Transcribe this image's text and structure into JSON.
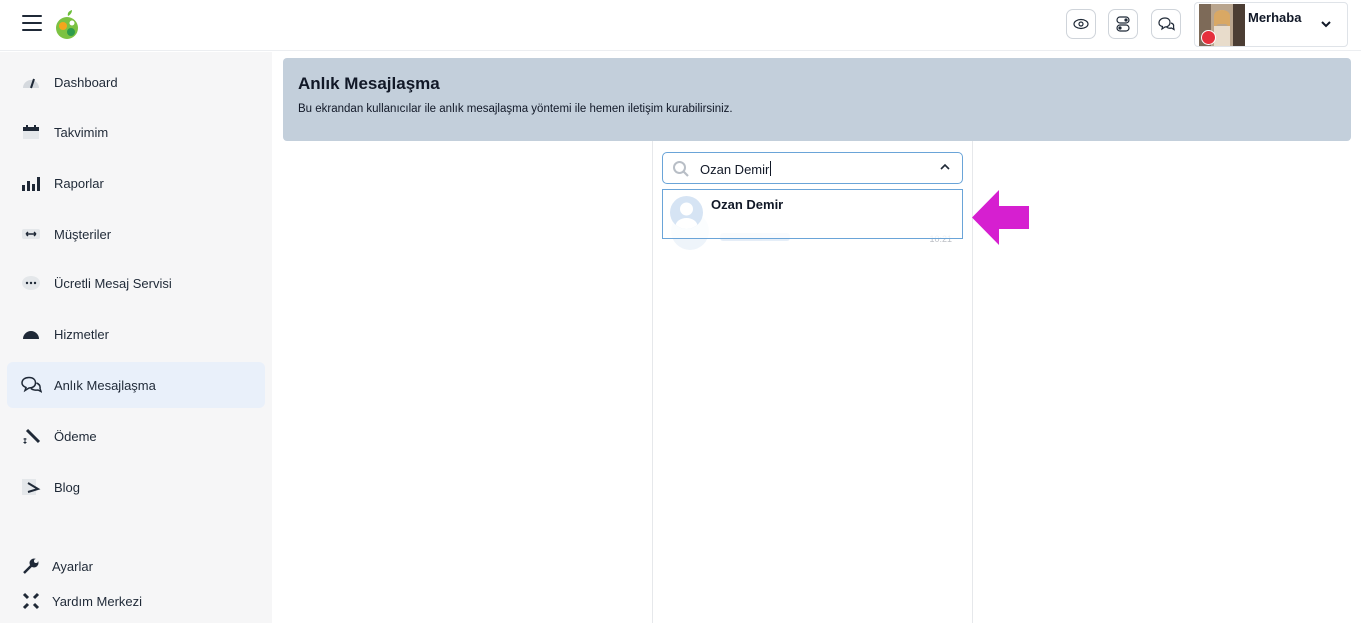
{
  "header": {
    "greeting": "Merhaba",
    "icons": [
      "eye-icon",
      "toggle-icon",
      "chat-icon"
    ]
  },
  "sidebar": {
    "items": [
      {
        "label": "Dashboard",
        "icon": "gauge-icon"
      },
      {
        "label": "Takvimim",
        "icon": "calendar-icon"
      },
      {
        "label": "Raporlar",
        "icon": "bar-chart-icon"
      },
      {
        "label": "Müşteriler",
        "icon": "customers-icon"
      },
      {
        "label": "Ücretli Mesaj Servisi",
        "icon": "message-dots-icon"
      },
      {
        "label": "Hizmetler",
        "icon": "services-icon"
      },
      {
        "label": "Anlık Mesajlaşma",
        "icon": "chat-icon",
        "active": true
      },
      {
        "label": "Ödeme",
        "icon": "payment-icon"
      },
      {
        "label": "Blog",
        "icon": "blog-icon"
      }
    ],
    "bottom_items": [
      {
        "label": "Ayarlar",
        "icon": "wrench-icon"
      },
      {
        "label": "Yardım Merkezi",
        "icon": "help-icon"
      }
    ]
  },
  "page": {
    "title": "Anlık Mesajlaşma",
    "subtitle": "Bu ekrandan kullanıcılar ile anlık mesajlaşma yöntemi ile hemen iletişim kurabilirsiniz."
  },
  "search": {
    "value": "Ozan Demir"
  },
  "dropdown": {
    "options": [
      {
        "name": "Ozan Demir"
      }
    ]
  },
  "chat_list": {
    "preview_time": "10:21"
  },
  "colors": {
    "banner": "#c3cfdb",
    "active_nav": "#e9f0fa",
    "focus_border": "#6aa4d8",
    "arrow": "#d61fd0",
    "status_dot": "#e5303c"
  }
}
